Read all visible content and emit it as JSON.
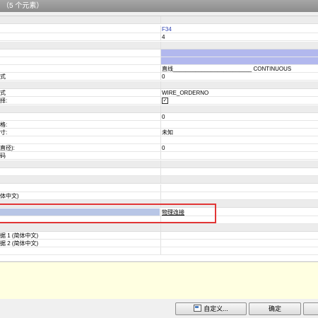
{
  "title_bar": {
    "text": "（5 个元素）"
  },
  "rows": [
    {
      "kind": "cat",
      "left": "",
      "right": ""
    },
    {
      "kind": "row",
      "left": "",
      "right": "F34",
      "right_class": "blue"
    },
    {
      "kind": "row",
      "left": "",
      "right": "4"
    },
    {
      "kind": "cat",
      "left": "",
      "right": ""
    },
    {
      "kind": "row",
      "left": "",
      "right": "",
      "right_class": "lav"
    },
    {
      "kind": "row",
      "left": "",
      "right": "",
      "right_class": "lav"
    },
    {
      "kind": "row",
      "left": "",
      "right": "直线_________________________ CONTINUOUS"
    },
    {
      "kind": "row",
      "left": "式",
      "right": "0"
    },
    {
      "kind": "cat",
      "left": "",
      "right": ""
    },
    {
      "kind": "row",
      "left": "式",
      "right": "WIRE_ORDERNO"
    },
    {
      "kind": "row",
      "left": "择:",
      "right": "",
      "check": true
    },
    {
      "kind": "cat",
      "left": "",
      "right": ""
    },
    {
      "kind": "row",
      "left": "",
      "right": "0"
    },
    {
      "kind": "row",
      "left": "格:",
      "right": ""
    },
    {
      "kind": "row",
      "left": "寸:",
      "right": "未知"
    },
    {
      "kind": "row",
      "left": "",
      "right": ""
    },
    {
      "kind": "row",
      "left": "直径):",
      "right": "0"
    },
    {
      "kind": "row",
      "left": "码",
      "right": ""
    },
    {
      "kind": "cat",
      "left": "",
      "right": ""
    },
    {
      "kind": "row",
      "left": "",
      "right": ""
    },
    {
      "kind": "cat",
      "left": "",
      "right": ""
    },
    {
      "kind": "row",
      "left": "",
      "right": ""
    },
    {
      "kind": "row",
      "left": "体中文)",
      "right": ""
    },
    {
      "kind": "cat",
      "left": "",
      "right": ""
    },
    {
      "kind": "row",
      "left": "",
      "right": "物理连接",
      "left_class": "sel",
      "right_class": "underline"
    },
    {
      "kind": "row",
      "left": "",
      "right": ""
    },
    {
      "kind": "cat",
      "left": "",
      "right": ""
    },
    {
      "kind": "row",
      "left": "据 1 (简体中文)",
      "right": ""
    },
    {
      "kind": "row",
      "left": "据 2 (简体中文)",
      "right": ""
    },
    {
      "kind": "row",
      "left": "",
      "right": ""
    }
  ],
  "buttons": {
    "customize": "自定义...",
    "ok": "确定"
  },
  "icons": {
    "customize": "dialog-icon"
  }
}
